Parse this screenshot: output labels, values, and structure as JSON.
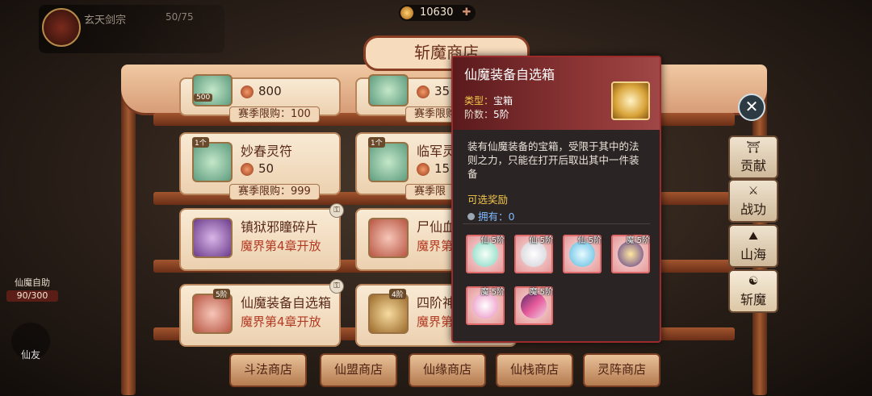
{
  "top": {
    "guild_name": "玄天剑宗",
    "guild_count": "50/75",
    "currency_value": "10630"
  },
  "shop": {
    "title": "斩魔商店",
    "cards": [
      {
        "name": "",
        "price": "800",
        "limit": "赛季限购：100",
        "badge": "500"
      },
      {
        "name": "",
        "price": "35",
        "limit": "赛季限购"
      },
      {
        "name": "妙春灵符",
        "price": "50",
        "limit": "赛季限购：999",
        "badge": "1个"
      },
      {
        "name": "临军灵",
        "price": "15",
        "limit": "赛季限",
        "badge": "1个"
      },
      {
        "name": "镇狱邪瞳碎片",
        "req": "魔界第4章开放"
      },
      {
        "name": "尸仙血",
        "req": "魔界第"
      },
      {
        "name": "仙魔装备自选箱",
        "req": "魔界第4章开放",
        "badge": "5阶"
      },
      {
        "name": "四阶神",
        "req": "魔界第",
        "badge": "4阶"
      }
    ],
    "bottom_tabs": [
      "斗法商店",
      "仙盟商店",
      "仙缘商店",
      "仙栈商店",
      "灵阵商店"
    ],
    "side_tabs": [
      "贡献",
      "战功",
      "山海",
      "斩魔"
    ]
  },
  "left": {
    "activity_label": "仙魔自助",
    "activity_progress": "90/300",
    "friend_label": "仙友"
  },
  "popup": {
    "title": "仙魔装备自选箱",
    "type_label": "类型：",
    "type_value": "宝箱",
    "tier_label": "阶数：",
    "tier_value": "5阶",
    "description": "装有仙魔装备的宝箱，受限于其中的法则之力，只能在打开后取出其中一件装备",
    "selectable_rewards": "可选奖励",
    "owned_label": "拥有：",
    "owned_value": "0",
    "items": [
      {
        "tag": "仙·5阶",
        "art": "a1"
      },
      {
        "tag": "仙·5阶",
        "art": "a2"
      },
      {
        "tag": "仙·5阶",
        "art": "a3"
      },
      {
        "tag": "魔·5阶",
        "art": "a4"
      },
      {
        "tag": "魔·5阶",
        "art": "a5"
      },
      {
        "tag": "魔·5阶",
        "art": "a6"
      }
    ]
  }
}
